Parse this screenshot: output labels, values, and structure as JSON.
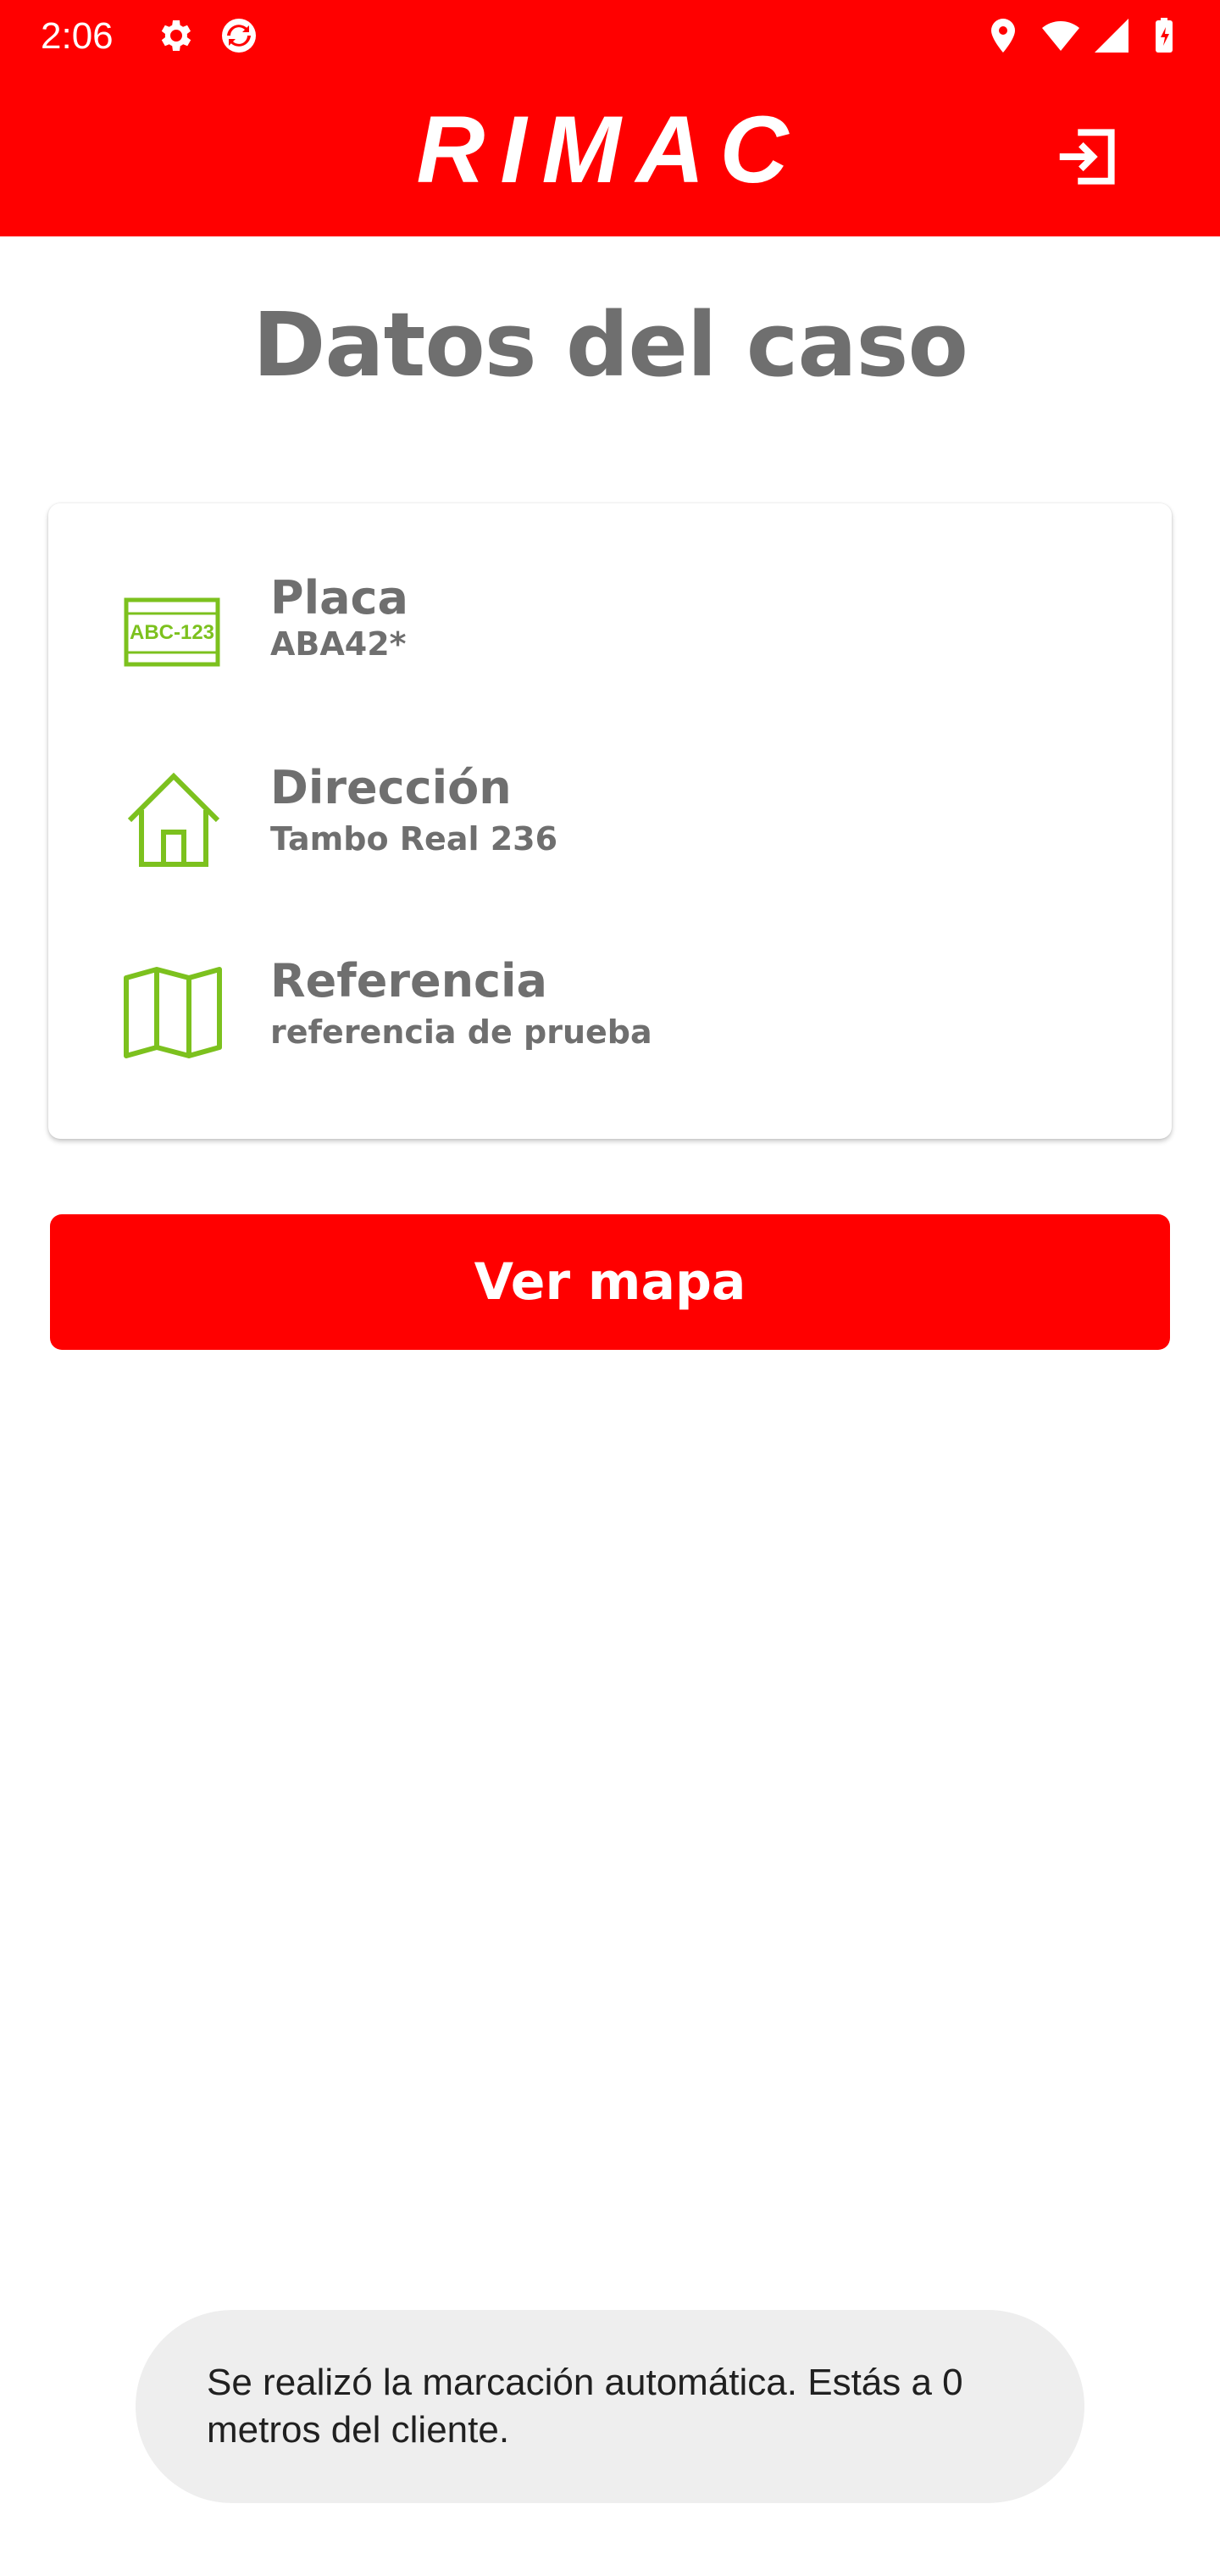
{
  "status_bar": {
    "time": "2:06",
    "icons": [
      "settings-icon",
      "sync-app-icon",
      "location-icon",
      "wifi-icon",
      "signal-icon",
      "battery-icon"
    ]
  },
  "header": {
    "logo_text": "RIMAC",
    "logout_icon": "logout-icon",
    "background_color": "#ff0000"
  },
  "page": {
    "title": "Datos del caso"
  },
  "case_details": [
    {
      "label": "Placa",
      "value": "ABA42*",
      "icon": "license-plate-icon",
      "icon_text": "ABC-123"
    },
    {
      "label": "Dirección",
      "value": "Tambo Real 236",
      "icon": "house-icon"
    },
    {
      "label": "Referencia",
      "value": "referencia de prueba",
      "icon": "map-icon"
    }
  ],
  "actions": {
    "map_button_label": "Ver mapa"
  },
  "toast": {
    "message": "Se realizó la marcación automática. Estás a 0 metros del cliente."
  },
  "colors": {
    "brand_red": "#ff0000",
    "icon_green": "#7cc11e",
    "text_gray": "#6f6f6f"
  }
}
